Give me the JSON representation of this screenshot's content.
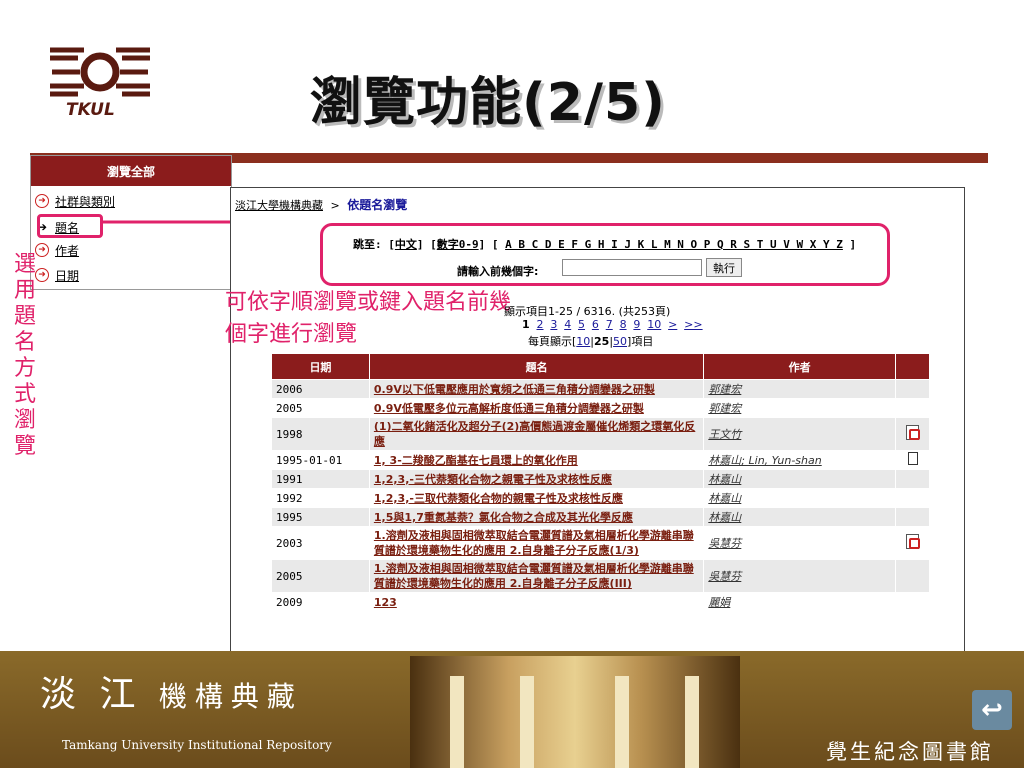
{
  "slide": {
    "title": "瀏覽功能(2/5)",
    "logo_text": "TKUL"
  },
  "nav": {
    "header": "瀏覽全部",
    "items": [
      {
        "label": "社群與類別"
      },
      {
        "label": "題名"
      },
      {
        "label": "作者"
      },
      {
        "label": "日期"
      }
    ]
  },
  "side_label": "選用題名方式瀏覽",
  "note": "可依字順瀏覽或鍵入題名前幾個字進行瀏覽",
  "browse": {
    "breadcrumb_root": "淡江大學機構典藏",
    "breadcrumb_sep": ">",
    "breadcrumb_current": "依題名瀏覽",
    "jump_label": "跳至:",
    "jump_chinese": "中文",
    "jump_digits": "數字0-9",
    "jump_letters": "A B C D E F G H I J K L M N O P Q R S T U V W X Y Z",
    "prefix_label": "請輸入前幾個字:",
    "prefix_value": "",
    "go_button": "執行",
    "result_info": "顯示項目1-25 / 6316. (共253頁)",
    "pager_current": "1",
    "pager_links": [
      "2",
      "3",
      "4",
      "5",
      "6",
      "7",
      "8",
      "9",
      "10",
      ">",
      ">>"
    ],
    "perpage_prefix": "每頁顯示[",
    "perpage_10": "10",
    "perpage_25": "25",
    "perpage_50": "50",
    "perpage_suffix": "]項目"
  },
  "table": {
    "headers": {
      "date": "日期",
      "title": "題名",
      "author": "作者",
      "file": ""
    },
    "rows": [
      {
        "date": "2006",
        "title": "0.9V以下低電壓應用於寬頻之低通三角積分調變器之研製",
        "author": "郭建宏",
        "file": ""
      },
      {
        "date": "2005",
        "title": "0.9V低電壓多位元高解析度低通三角積分調變器之研製",
        "author": "郭建宏",
        "file": ""
      },
      {
        "date": "1998",
        "title": "(1)二氧化鍺活化及超分子(2)高價態過渡金屬催化烯類之環氧化反應",
        "author": "王文竹",
        "file": "pdf"
      },
      {
        "date": "1995-01-01",
        "title": "1, 3-二羧酸乙酯基在七員環上的氧化作用",
        "author": "林嘉山; Lin, Yun-shan",
        "file": "doc"
      },
      {
        "date": "1991",
        "title": "1,2,3,-三代萘類化合物之親電子性及求核性反應",
        "author": "林嘉山",
        "file": ""
      },
      {
        "date": "1992",
        "title": "1,2,3,-三取代萘類化合物的親電子性及求核性反應",
        "author": "林嘉山",
        "file": ""
      },
      {
        "date": "1995",
        "title": "1,5與1,7重氮基萘？氯化合物之合成及其光化學反應",
        "author": "林嘉山",
        "file": ""
      },
      {
        "date": "2003",
        "title": "1.溶劑及液相與固相微萃取結合電灑質譜及氣相層析化學游離串聯質譜於環境藥物生化的應用 2.自身離子分子反應(1/3)",
        "author": "吳慧芬",
        "file": "pdf"
      },
      {
        "date": "2005",
        "title": "1.溶劑及液相與固相微萃取結合電灑質譜及氣相層析化學游離串聯質譜於環境藥物生化的應用 2.自身離子分子反應(III)",
        "author": "吳慧芬",
        "file": ""
      },
      {
        "date": "2009",
        "title": "123",
        "author": "麗娟",
        "file": ""
      }
    ]
  },
  "footer": {
    "brand_big": "淡 江",
    "brand_small": "機構典藏",
    "brand_en": "Tamkang University Institutional Repository",
    "library": "覺生紀念圖書館",
    "back_icon": "↩"
  },
  "colors": {
    "accent": "#e0226a",
    "brand": "#8b1c1c",
    "footer": "#7a5a22"
  }
}
